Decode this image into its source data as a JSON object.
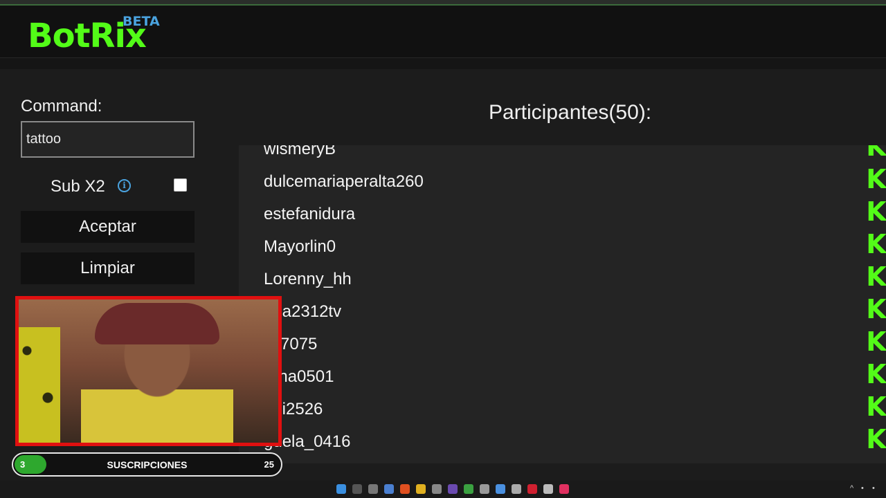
{
  "app": {
    "logo": "BotRix",
    "badge": "BETA"
  },
  "command": {
    "label": "Command:",
    "value": "tattoo",
    "sub_label": "Sub X2",
    "sub_checked": false,
    "accept_label": "Aceptar",
    "clear_label": "Limpiar"
  },
  "participants": {
    "title": "Participantes(50):",
    "items": [
      "wismeryB",
      "dulcemariaperalta260",
      "estefanidura",
      "Mayorlin0",
      "Lorenny_hh",
      "aria2312tv",
      "li07075",
      "rena0501",
      "arii2526",
      "guela_0416"
    ],
    "platform_icon": "kick-icon"
  },
  "subscriptions": {
    "start": "3",
    "label": "SUSCRIPCIONES",
    "goal": "25",
    "progress": 0.12
  },
  "colors": {
    "brand": "#53fc18",
    "beta": "#4aa3df",
    "webcam_border": "#e01010",
    "progress": "#2ea82e"
  }
}
